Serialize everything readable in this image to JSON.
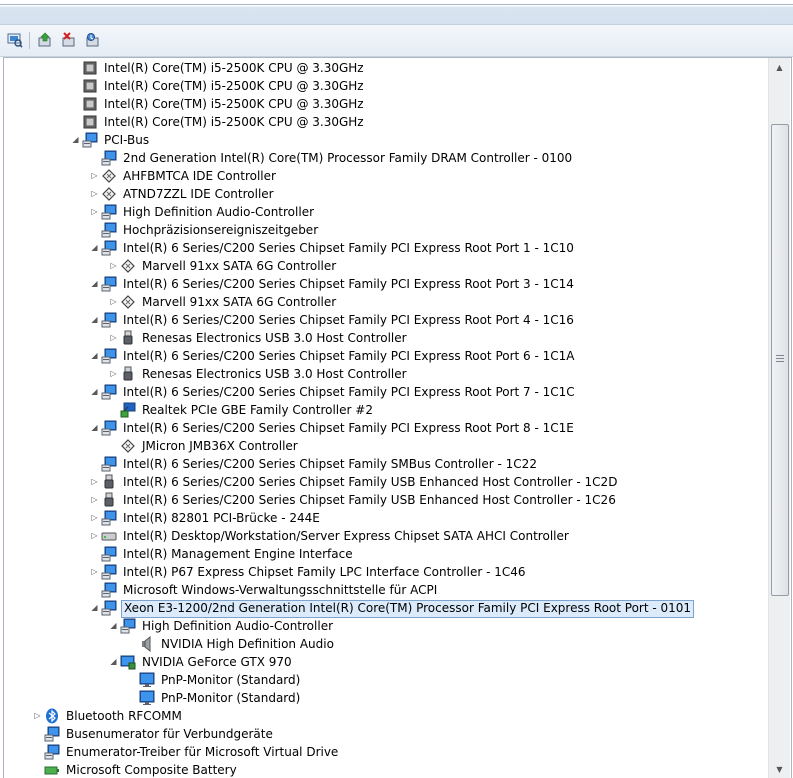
{
  "toolbar": {
    "buttons": [
      {
        "name": "scan-hardware-icon"
      },
      {
        "name": "update-driver-icon"
      },
      {
        "name": "uninstall-icon"
      },
      {
        "name": "properties-icon"
      }
    ]
  },
  "tree": [
    {
      "label": "Intel(R) Core(TM) i5-2500K CPU @ 3.30GHz",
      "level": 2,
      "icon": "cpu",
      "expander": "none"
    },
    {
      "label": "Intel(R) Core(TM) i5-2500K CPU @ 3.30GHz",
      "level": 2,
      "icon": "cpu",
      "expander": "none"
    },
    {
      "label": "Intel(R) Core(TM) i5-2500K CPU @ 3.30GHz",
      "level": 2,
      "icon": "cpu",
      "expander": "none"
    },
    {
      "label": "Intel(R) Core(TM) i5-2500K CPU @ 3.30GHz",
      "level": 2,
      "icon": "cpu",
      "expander": "none"
    },
    {
      "label": "PCI-Bus",
      "level": 2,
      "icon": "computer",
      "expander": "open"
    },
    {
      "label": "2nd Generation Intel(R) Core(TM) Processor Family DRAM Controller - 0100",
      "level": 3,
      "icon": "computer",
      "expander": "none"
    },
    {
      "label": "AHFBMTCA IDE Controller",
      "level": 3,
      "icon": "ide",
      "expander": "closed"
    },
    {
      "label": "ATND7ZZL IDE Controller",
      "level": 3,
      "icon": "ide",
      "expander": "closed"
    },
    {
      "label": "High Definition Audio-Controller",
      "level": 3,
      "icon": "computer",
      "expander": "closed"
    },
    {
      "label": "Hochpräzisionsereigniszeitgeber",
      "level": 3,
      "icon": "computer",
      "expander": "none"
    },
    {
      "label": "Intel(R) 6 Series/C200 Series Chipset Family PCI Express Root Port 1 - 1C10",
      "level": 3,
      "icon": "computer",
      "expander": "open"
    },
    {
      "label": "Marvell 91xx SATA 6G Controller",
      "level": 4,
      "icon": "ide",
      "expander": "closed"
    },
    {
      "label": "Intel(R) 6 Series/C200 Series Chipset Family PCI Express Root Port 3 - 1C14",
      "level": 3,
      "icon": "computer",
      "expander": "open"
    },
    {
      "label": "Marvell 91xx SATA 6G Controller",
      "level": 4,
      "icon": "ide",
      "expander": "closed"
    },
    {
      "label": "Intel(R) 6 Series/C200 Series Chipset Family PCI Express Root Port 4 - 1C16",
      "level": 3,
      "icon": "computer",
      "expander": "open"
    },
    {
      "label": "Renesas Electronics USB 3.0 Host Controller",
      "level": 4,
      "icon": "usb",
      "expander": "closed"
    },
    {
      "label": "Intel(R) 6 Series/C200 Series Chipset Family PCI Express Root Port 6 - 1C1A",
      "level": 3,
      "icon": "computer",
      "expander": "open"
    },
    {
      "label": "Renesas Electronics USB 3.0 Host Controller",
      "level": 4,
      "icon": "usb",
      "expander": "closed"
    },
    {
      "label": "Intel(R) 6 Series/C200 Series Chipset Family PCI Express Root Port 7 - 1C1C",
      "level": 3,
      "icon": "computer",
      "expander": "open"
    },
    {
      "label": "Realtek PCIe GBE Family Controller #2",
      "level": 4,
      "icon": "network",
      "expander": "none"
    },
    {
      "label": "Intel(R) 6 Series/C200 Series Chipset Family PCI Express Root Port 8 - 1C1E",
      "level": 3,
      "icon": "computer",
      "expander": "open"
    },
    {
      "label": "JMicron JMB36X Controller",
      "level": 4,
      "icon": "ide",
      "expander": "none"
    },
    {
      "label": "Intel(R) 6 Series/C200 Series Chipset Family SMBus Controller - 1C22",
      "level": 3,
      "icon": "computer",
      "expander": "none"
    },
    {
      "label": "Intel(R) 6 Series/C200 Series Chipset Family USB Enhanced Host Controller - 1C2D",
      "level": 3,
      "icon": "usb",
      "expander": "closed"
    },
    {
      "label": "Intel(R) 6 Series/C200 Series Chipset Family USB Enhanced Host Controller - 1C26",
      "level": 3,
      "icon": "usb",
      "expander": "closed"
    },
    {
      "label": "Intel(R) 82801 PCI-Brücke - 244E",
      "level": 3,
      "icon": "computer",
      "expander": "closed"
    },
    {
      "label": "Intel(R) Desktop/Workstation/Server Express Chipset SATA AHCI Controller",
      "level": 3,
      "icon": "disk",
      "expander": "closed"
    },
    {
      "label": "Intel(R) Management Engine Interface",
      "level": 3,
      "icon": "computer",
      "expander": "none"
    },
    {
      "label": "Intel(R) P67 Express Chipset Family LPC Interface Controller - 1C46",
      "level": 3,
      "icon": "computer",
      "expander": "closed"
    },
    {
      "label": "Microsoft Windows-Verwaltungsschnittstelle für ACPI",
      "level": 3,
      "icon": "computer",
      "expander": "none"
    },
    {
      "label": "Xeon E3-1200/2nd Generation Intel(R) Core(TM) Processor Family PCI Express Root Port - 0101",
      "level": 3,
      "icon": "computer",
      "expander": "open",
      "selected": true
    },
    {
      "label": "High Definition Audio-Controller",
      "level": 4,
      "icon": "computer",
      "expander": "open"
    },
    {
      "label": "NVIDIA High Definition Audio",
      "level": 5,
      "icon": "speaker",
      "expander": "none"
    },
    {
      "label": "NVIDIA GeForce GTX 970",
      "level": 4,
      "icon": "display",
      "expander": "open"
    },
    {
      "label": "PnP-Monitor (Standard)",
      "level": 5,
      "icon": "monitor",
      "expander": "none"
    },
    {
      "label": "PnP-Monitor (Standard)",
      "level": 5,
      "icon": "monitor",
      "expander": "none"
    },
    {
      "label": "Bluetooth RFCOMM",
      "level": 0,
      "icon": "bluetooth",
      "expander": "closed"
    },
    {
      "label": "Busenumerator für Verbundgeräte",
      "level": 0,
      "icon": "computer",
      "expander": "none"
    },
    {
      "label": "Enumerator-Treiber für Microsoft Virtual Drive",
      "level": 0,
      "icon": "computer",
      "expander": "none"
    },
    {
      "label": "Microsoft Composite Battery",
      "level": 0,
      "icon": "battery",
      "expander": "none"
    }
  ]
}
